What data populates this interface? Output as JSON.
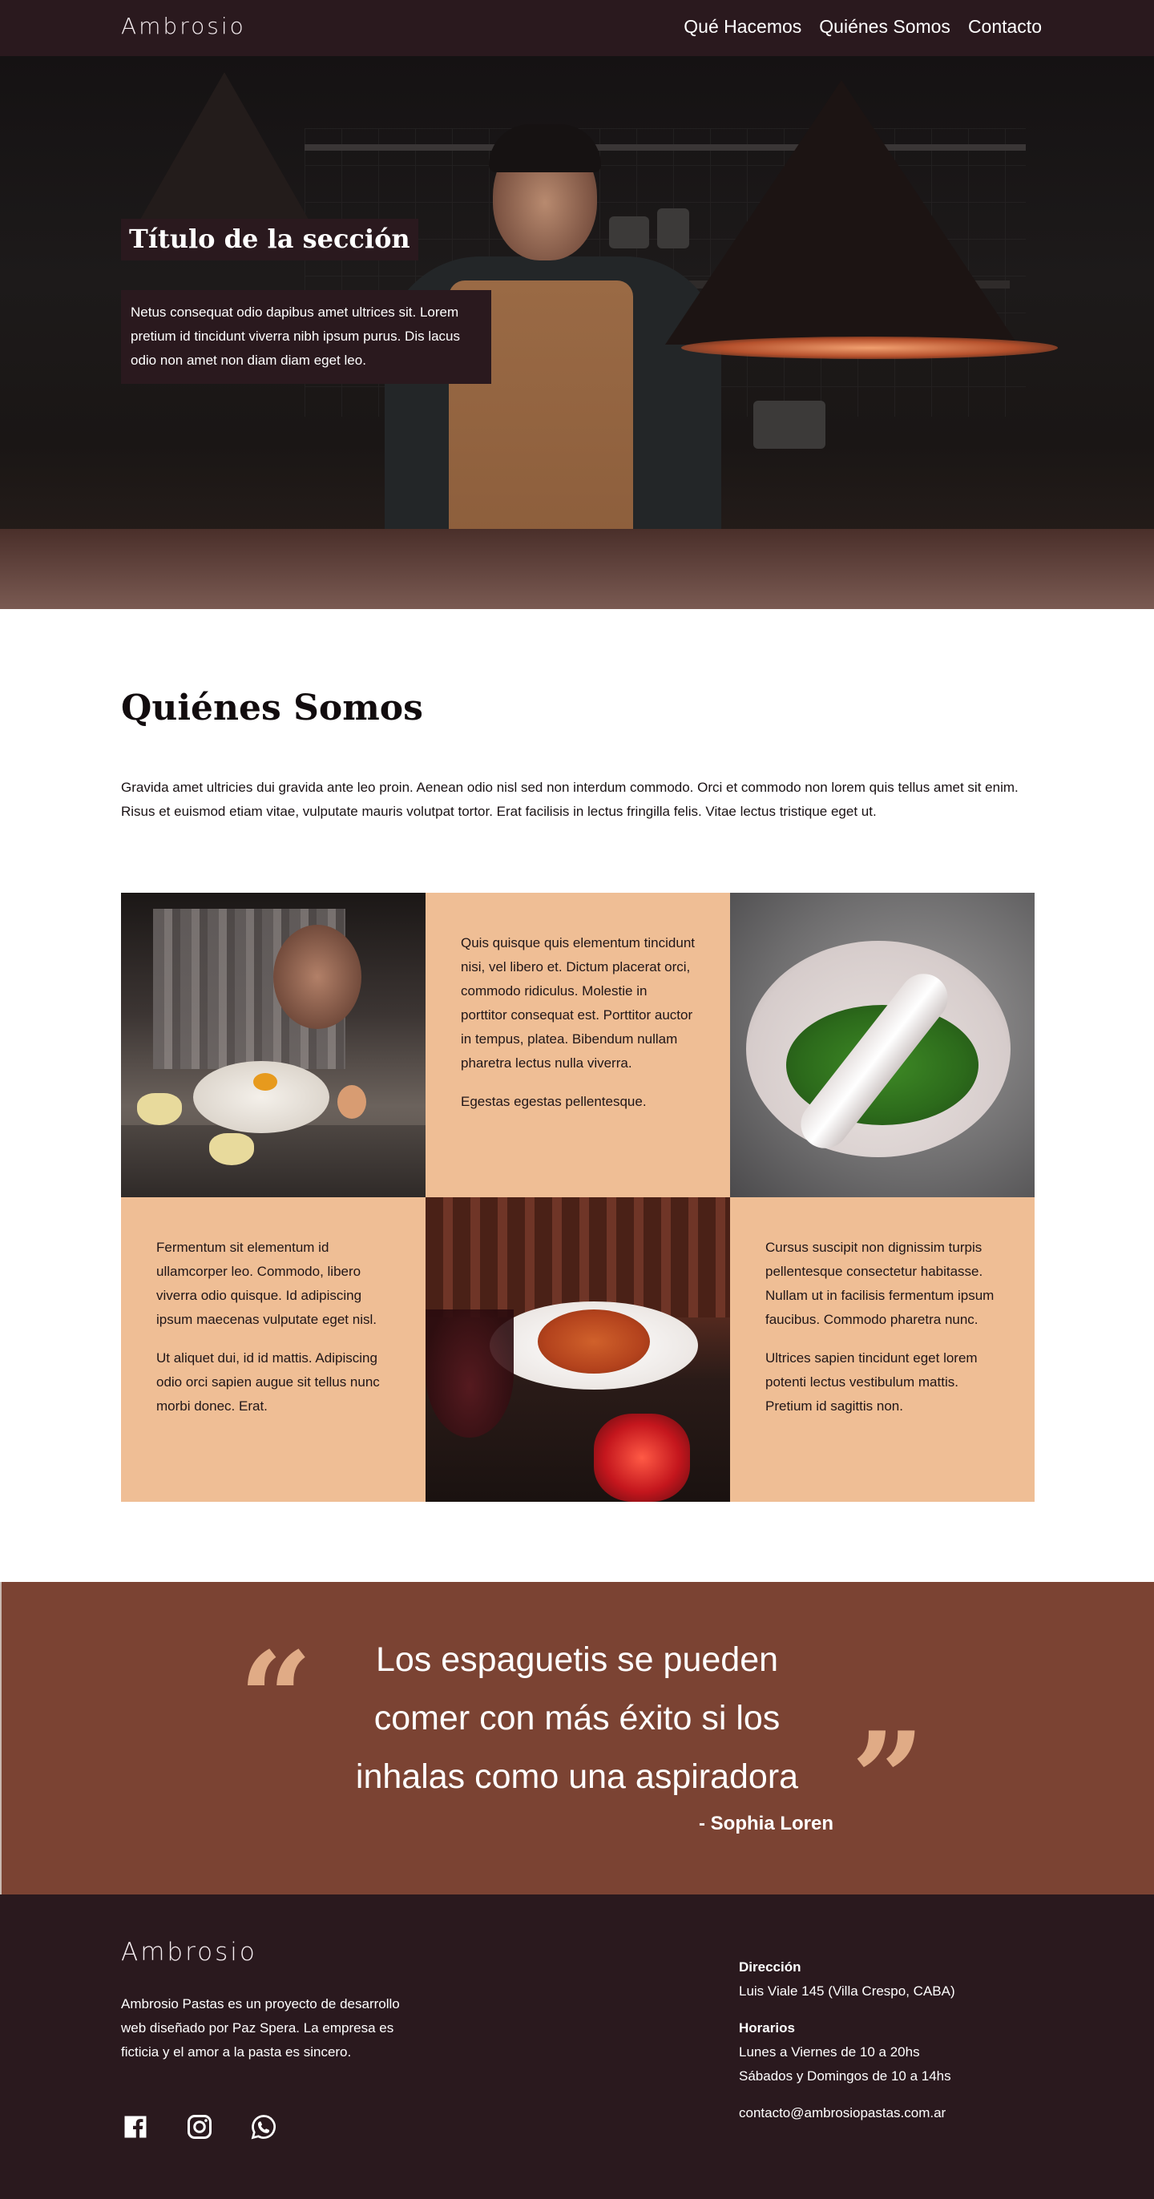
{
  "nav": {
    "logo": "Ambrosio",
    "links": [
      "Qué Hacemos",
      "Quiénes Somos",
      "Contacto"
    ]
  },
  "hero": {
    "title": "Título de la sección",
    "text": "Netus consequat odio dapibus amet ultrices sit. Lorem pretium id tincidunt viverra nibh ipsum purus. Dis lacus odio non amet non diam diam eget leo."
  },
  "about": {
    "title": "Quiénes Somos",
    "text": "Gravida amet ultricies dui gravida ante leo proin. Aenean odio nisl sed non interdum commodo. Orci et commodo non lorem quis tellus amet sit enim. Risus et euismod etiam vitae, vulputate mauris volutpat tortor. Erat facilisis in lectus fringilla felis. Vitae lectus tristique eget ut."
  },
  "grid": {
    "cell2": [
      "Quis quisque quis elementum tincidunt nisi, vel libero et. Dictum placerat orci, commodo ridiculus. Molestie in porttitor consequat est. Porttitor auctor in tempus, platea. Bibendum nullam pharetra lectus nulla viverra.",
      "Egestas egestas pellentesque."
    ],
    "cell4": [
      "Fermentum sit elementum id ullamcorper leo. Commodo, libero viverra odio quisque. Id adipiscing ipsum maecenas vulputate eget nisl.",
      "Ut aliquet dui, id id mattis. Adipiscing odio orci sapien augue sit tellus nunc morbi donec. Erat."
    ],
    "cell6": [
      "Cursus suscipit non dignissim turpis pellentesque consectetur habitasse. Nullam ut in facilisis fermentum ipsum faucibus. Commodo pharetra nunc.",
      "Ultrices sapien tincidunt eget lorem potenti lectus vestibulum mattis. Pretium id sagittis non."
    ]
  },
  "quote": {
    "text": "Los espaguetis se pueden comer con más éxito si los inhalas como una aspiradora",
    "author": "- Sophia Loren"
  },
  "footer": {
    "logo": "Ambrosio",
    "description": "Ambrosio Pastas es un proyecto de desarrollo web diseñado por Paz Spera. La empresa es ficticia y el amor a la pasta es sincero.",
    "address_label": "Dirección",
    "address": "Luis Viale 145 (Villa Crespo, CABA)",
    "hours_label": "Horarios",
    "hours_weekdays": "Lunes a Viernes de 10 a 20hs",
    "hours_weekend": "Sábados y Domingos de 10 a 14hs",
    "email": "contacto@ambrosiopastas.com.ar",
    "socials": [
      "facebook-icon",
      "instagram-icon",
      "whatsapp-icon"
    ]
  },
  "colors": {
    "dark": "#2a191e",
    "peach": "#efbe95",
    "quote_bg": "#7b4333",
    "quote_marks": "#e0ab86"
  }
}
